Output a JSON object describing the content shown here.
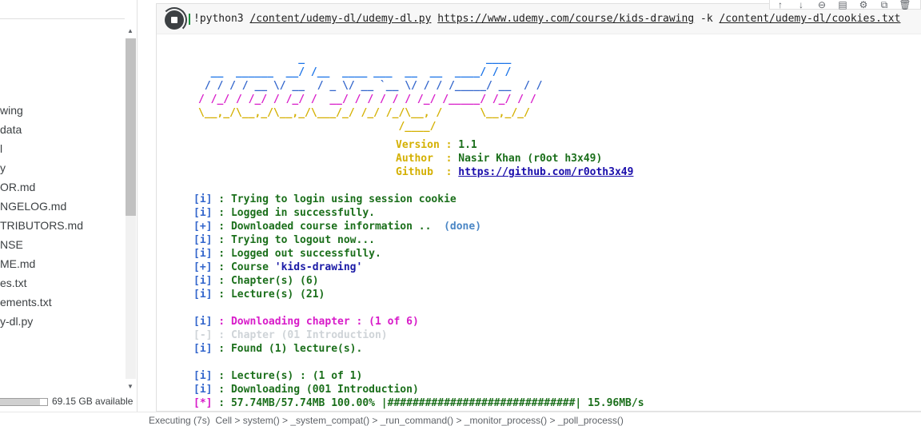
{
  "file_panel": {
    "files": [
      "wing",
      "data",
      "l",
      "y",
      "OR.md",
      "NGELOG.md",
      "TRIBUTORS.md",
      "NSE",
      "ME.md",
      "es.txt",
      "ements.txt",
      "y-dl.py"
    ],
    "disk_available": "69.15 GB available",
    "disk_used_fraction": 0.85
  },
  "cell": {
    "command_prefix": "!python3 ",
    "script_path": "/content/udemy-dl/udemy-dl.py",
    "url": "https://www.udemy.com/course/kids-drawing",
    "flag": " -k ",
    "cookie_path": "/content/udemy-dl/cookies.txt",
    "toolbar_icons": [
      "arrow-up-icon",
      "arrow-down-icon",
      "link-icon",
      "comment-icon",
      "settings-icon",
      "mirror-cell-icon",
      "delete-icon"
    ]
  },
  "output": {
    "banner": [
      {
        "text": "                _                             ____",
        "color": "c-blue"
      },
      {
        "text": "  __  ______  __/ /__  ____ ___  __  __  ____/ / /",
        "color": "c-blue"
      },
      {
        "text": " / / / / __ \\/ __  / _ \\/ __ `__ \\/ / / /_____/ __  / /",
        "color": "c-blue-dark"
      },
      {
        "text": "/ /_/ / /_/ / /_/ /  __/ / / / / / /_/ /_____/ /_/ / /",
        "color": "c-magenta"
      },
      {
        "text": "\\__,_/\\__,_/\\__,_/\\___/_/ /_/ /_/\\__, /      \\__,_/_/",
        "color": "c-yellow"
      },
      {
        "text": "                                /____/",
        "color": "c-yellow"
      }
    ],
    "version_label": "Version : ",
    "version_value": "1.1",
    "author_label": "Author  : ",
    "author_value": "Nasir Khan (r0ot h3x49)",
    "github_label": "Github  : ",
    "github_value": "https://github.com/r0oth3x49",
    "log": [
      {
        "tag": "[i]",
        "msg": " : Trying to login using session cookie",
        "color": "c-green"
      },
      {
        "tag": "[i]",
        "msg": " : Logged in successfully.",
        "color": "c-green"
      },
      {
        "tag": "[+]",
        "msg": " : Downloaded course information ..  ",
        "extra": "(done)",
        "color": "c-green"
      },
      {
        "tag": "[i]",
        "msg": " : Trying to logout now...",
        "color": "c-green"
      },
      {
        "tag": "[i]",
        "msg": " : Logged out successfully.",
        "color": "c-green"
      },
      {
        "tag": "[+]",
        "msg": " : Course ",
        "course": "'kids-drawing'",
        "color": "c-green"
      },
      {
        "tag": "[i]",
        "msg": " : Chapter(s) (6)",
        "color": "c-green"
      },
      {
        "tag": "[i]",
        "msg": " : Lecture(s) (21)",
        "color": "c-green"
      },
      {
        "tag": "[i]",
        "msg": " : Downloading chapter : (1 of 6)",
        "color": "c-magenta"
      },
      {
        "tag": "[-]",
        "msg": " : Chapter (01 Introduction)",
        "color": "c-faded"
      },
      {
        "tag": "[i]",
        "msg": " : Found (1) lecture(s).",
        "color": "c-green"
      },
      {
        "tag": "[i]",
        "msg": " : Lecture(s) : (1 of 1)",
        "color": "c-green"
      },
      {
        "tag": "[i]",
        "msg": " : Downloading (001 Introduction)",
        "color": "c-green"
      },
      {
        "tag": "[*]",
        "msg": " : 57.74MB/57.74MB 100.00% |##############################| 15.96MB/s",
        "color": "c-green"
      }
    ]
  },
  "status_bar": {
    "text": "Executing (7s)  Cell > system() > _system_compat() > _run_command() > _monitor_process() > _poll_process()"
  }
}
